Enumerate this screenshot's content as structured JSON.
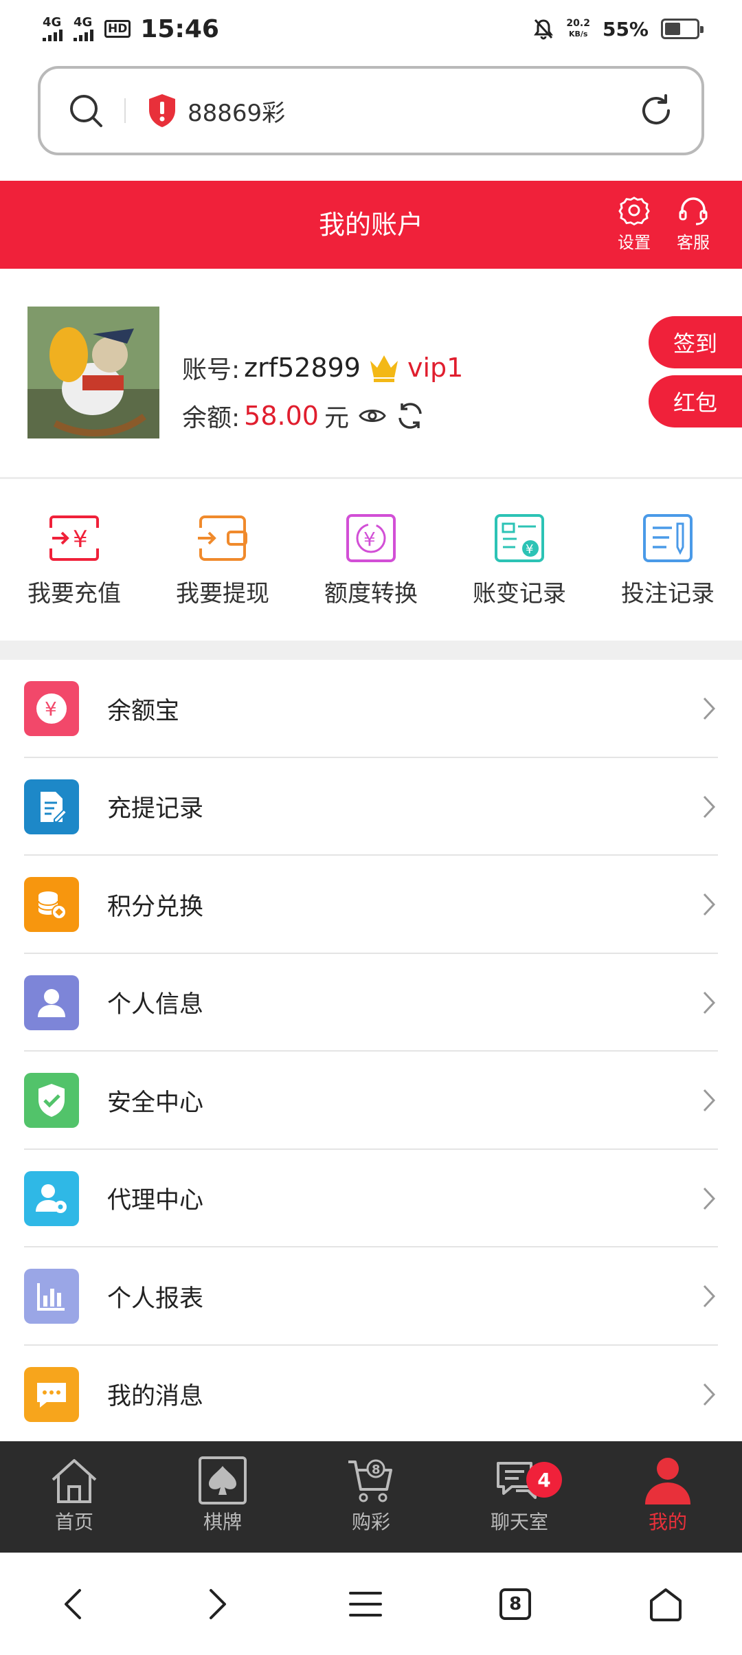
{
  "status": {
    "network1": "4G",
    "network2": "4G",
    "hd": "HD",
    "time": "15:46",
    "speed_value": "20.2",
    "speed_unit": "KB/s",
    "battery": "55%"
  },
  "browser": {
    "url_text": "88869彩"
  },
  "header": {
    "title": "我的账户",
    "settings": "设置",
    "service": "客服"
  },
  "profile": {
    "account_label": "账号:",
    "account": "zrf52899",
    "vip": "vip1",
    "balance_label": "余额:",
    "balance": "58.00",
    "currency": "元",
    "checkin": "签到",
    "redpacket": "红包"
  },
  "quick": [
    {
      "label": "我要充值",
      "icon": "recharge-icon",
      "color": "#f0213a"
    },
    {
      "label": "我要提现",
      "icon": "withdraw-icon",
      "color": "#f08a2c"
    },
    {
      "label": "额度转换",
      "icon": "transfer-icon",
      "color": "#d24fd6"
    },
    {
      "label": "账变记录",
      "icon": "account-record-icon",
      "color": "#2cc3b5"
    },
    {
      "label": "投注记录",
      "icon": "bet-record-icon",
      "color": "#4a9ae8"
    }
  ],
  "menu": [
    {
      "label": "余额宝",
      "color": "#f2486a"
    },
    {
      "label": "充提记录",
      "color": "#1d88c8"
    },
    {
      "label": "积分兑换",
      "color": "#f7960e"
    },
    {
      "label": "个人信息",
      "color": "#7d85d8"
    },
    {
      "label": "安全中心",
      "color": "#52c36a"
    },
    {
      "label": "代理中心",
      "color": "#2fb8e6"
    },
    {
      "label": "个人报表",
      "color": "#9aa6e6"
    },
    {
      "label": "我的消息",
      "color": "#f7a51c"
    }
  ],
  "tabs": [
    {
      "label": "首页"
    },
    {
      "label": "棋牌"
    },
    {
      "label": "购彩"
    },
    {
      "label": "聊天室",
      "badge": "4"
    },
    {
      "label": "我的"
    }
  ],
  "nav": {
    "tab_count": "8"
  },
  "colors": {
    "brand": "#f0213a",
    "tabbar_bg": "#2c2c2c"
  }
}
